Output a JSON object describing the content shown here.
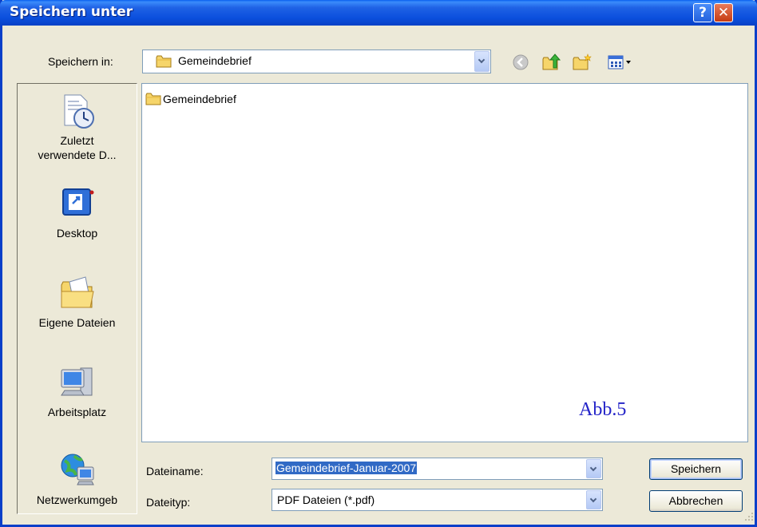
{
  "window": {
    "title": "Speichern unter"
  },
  "titlebar": {
    "help_glyph": "?",
    "close_glyph": "✕"
  },
  "save_in": {
    "label": "Speichern in:",
    "value": "Gemeindebrief"
  },
  "toolbar_icons": [
    "back-icon",
    "up-folder-icon",
    "new-folder-icon",
    "view-menu-icon"
  ],
  "places": [
    {
      "label_line1": "Zuletzt",
      "label_line2": "verwendete D...",
      "icon": "recent-docs-icon"
    },
    {
      "label_line1": "Desktop",
      "label_line2": "",
      "icon": "desktop-icon"
    },
    {
      "label_line1": "Eigene Dateien",
      "label_line2": "",
      "icon": "my-documents-icon"
    },
    {
      "label_line1": "Arbeitsplatz",
      "label_line2": "",
      "icon": "my-computer-icon"
    },
    {
      "label_line1": "Netzwerkumgeb",
      "label_line2": "",
      "icon": "network-icon"
    }
  ],
  "files": [
    {
      "name": "Gemeindebrief",
      "icon": "folder-icon"
    }
  ],
  "annotation": "Abb.5",
  "filename": {
    "label": "Dateiname:",
    "value": "Gemeindebrief-Januar-2007"
  },
  "filetype": {
    "label": "Dateityp:",
    "value": "PDF Dateien (*.pdf)"
  },
  "buttons": {
    "save": "Speichern",
    "cancel": "Abbrechen"
  },
  "colors": {
    "titlebar": "#0b4fdd",
    "selection": "#316ac5",
    "annotation": "#2323c8"
  }
}
